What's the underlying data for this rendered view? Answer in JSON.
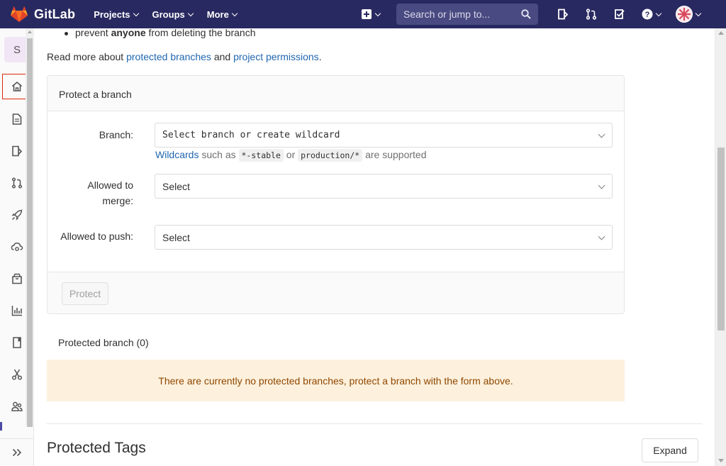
{
  "navbar": {
    "brand": "GitLab",
    "menu": [
      {
        "label": "Projects"
      },
      {
        "label": "Groups"
      },
      {
        "label": "More"
      }
    ],
    "search_placeholder": "Search or jump to...",
    "colors": {
      "background": "#292961",
      "search": "#4a4a82"
    }
  },
  "sidebar": {
    "project_letter": "S",
    "items": [
      "home-icon",
      "file-icon",
      "issues-icon",
      "merge-request-icon",
      "rocket-icon",
      "cloud-icon",
      "package-icon",
      "chart-icon",
      "book-icon",
      "scissors-icon",
      "members-icon"
    ],
    "active_item": "home-icon",
    "collapse_icon": "double-chevron-right-icon"
  },
  "content": {
    "bullet": {
      "prefix": "prevent ",
      "emphasis": "anyone",
      "suffix": " from deleting the branch"
    },
    "readmore": {
      "prefix": "Read more about ",
      "link1": "protected branches",
      "middle": " and ",
      "link2": "project permissions",
      "suffix": "."
    },
    "card": {
      "title": "Protect a branch",
      "branch_label": "Branch:",
      "branch_placeholder": "Select branch or create wildcard",
      "hint": {
        "link": "Wildcards",
        "text1": " such as ",
        "code1": "*-stable",
        "text2": " or ",
        "code2": "production/*",
        "text3": " are supported"
      },
      "merge_label": "Allowed to merge:",
      "merge_value": "Select",
      "push_label": "Allowed to push:",
      "push_value": "Select",
      "protect_button": "Protect"
    },
    "protected_branches_title": "Protected branch (0)",
    "empty_note": "There are currently no protected branches, protect a branch with the form above.",
    "protected_tags_title": "Protected Tags",
    "expand_button": "Expand",
    "colors": {
      "link": "#1f66b0",
      "warning_bg": "#fdf1dd",
      "warning_text": "#8f4700"
    }
  }
}
